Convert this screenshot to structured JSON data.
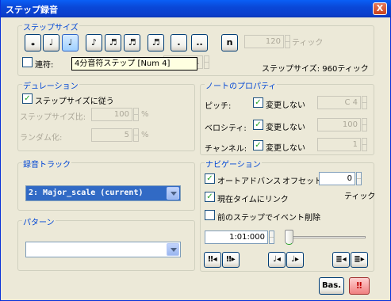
{
  "window": {
    "title": "ステップ録音",
    "close_label": "X"
  },
  "step_size": {
    "group_label": "ステップサイズ",
    "note_buttons": [
      "𝅝",
      "♩",
      "♩",
      "♪",
      "♬",
      "♬",
      "♬",
      ".",
      ".."
    ],
    "n_button": "n",
    "tick_value": "120",
    "tick_unit": "ティック",
    "renpu_label": "連符:",
    "renpu_value": "1",
    "current_size": "ステップサイズ: 960ティック"
  },
  "tooltip": {
    "text": "4分音符ステップ [Num 4]"
  },
  "duration": {
    "group_label": "デュレーション",
    "follow_label": "ステップサイズに従う",
    "ratio_label": "ステップサイズ比:",
    "ratio_value": "100",
    "ratio_unit": "%",
    "random_label": "ランダム化:",
    "random_value": "5",
    "random_unit": "%"
  },
  "note_props": {
    "group_label": "ノートのプロパティ",
    "pitch_label": "ピッチ:",
    "pitch_check": "変更しない",
    "pitch_value": "C 4",
    "velocity_label": "ベロシティ:",
    "velocity_check": "変更しない",
    "velocity_value": "100",
    "channel_label": "チャンネル:",
    "channel_check": "変更しない",
    "channel_value": "1"
  },
  "rec_track": {
    "group_label": "録音トラック",
    "selected": "2: Major_scale (current)"
  },
  "pattern": {
    "group_label": "パターン",
    "selected": ""
  },
  "navigation": {
    "group_label": "ナビゲーション",
    "auto_advance_label": "オートアドバンス",
    "offset_label": "オフセット:",
    "offset_value": "0",
    "tick_unit": "ティック",
    "link_label": "現在タイムにリンク",
    "delete_label": "前のステップでイベント削除",
    "time_value": "1:01:000"
  },
  "bottom": {
    "bas_label": "Bas."
  }
}
